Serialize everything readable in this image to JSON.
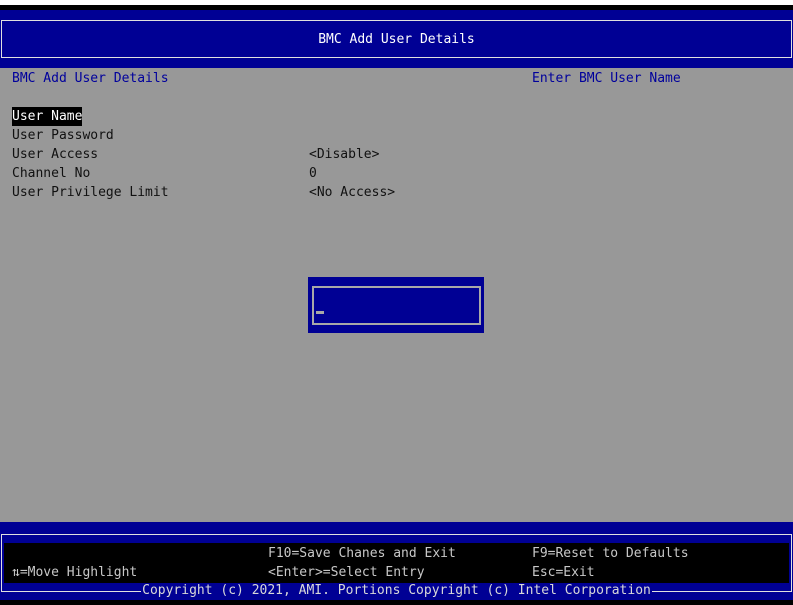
{
  "header": {
    "title": "BMC Add User Details"
  },
  "main": {
    "section_title": "BMC Add User Details",
    "help_text": "Enter BMC User Name",
    "items": [
      {
        "label": "User Name",
        "value": ""
      },
      {
        "label": "User Password",
        "value": ""
      },
      {
        "label": "User Access",
        "value": "<Disable>"
      },
      {
        "label": "Channel No",
        "value": "0"
      },
      {
        "label": "User Privilege Limit",
        "value": "<No Access>"
      }
    ]
  },
  "dialog": {
    "input_value": ""
  },
  "footer": {
    "move": "⇅=Move Highlight",
    "save": "F10=Save Chanes and Exit",
    "select": "<Enter>=Select Entry",
    "reset": "F9=Reset to Defaults",
    "exit": "Esc=Exit",
    "copyright": "Copyright (c) 2021, AMI. Portions Copyright (c) Intel Corporation"
  }
}
